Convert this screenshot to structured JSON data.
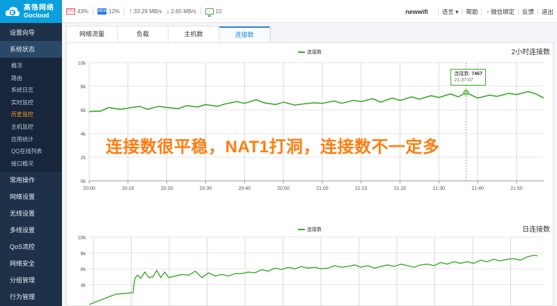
{
  "brand": {
    "name_cn": "高恪网络",
    "name_en": "Gocloud"
  },
  "sidebar": {
    "items_top": [
      {
        "label": "设置向导"
      },
      {
        "label": "系统状态"
      }
    ],
    "sub_items": [
      {
        "label": "概况"
      },
      {
        "label": "路由"
      },
      {
        "label": "系统日志"
      },
      {
        "label": "实时监控"
      },
      {
        "label": "历史监控",
        "active": true
      },
      {
        "label": "主机监控"
      },
      {
        "label": "应用统计"
      },
      {
        "label": "QQ在线列表"
      },
      {
        "label": "接口概况"
      }
    ],
    "items_bottom": [
      {
        "label": "常用操作"
      },
      {
        "label": "网络设置"
      },
      {
        "label": "无线设置"
      },
      {
        "label": "多线设置"
      },
      {
        "label": "QoS流控"
      },
      {
        "label": "网络安全"
      },
      {
        "label": "分组管理"
      },
      {
        "label": "行为管理"
      }
    ]
  },
  "topbar": {
    "cpu_icon_label": "CPU",
    "cpu": "43%",
    "mem_icon_label": "MEM",
    "mem": "12%",
    "upload": "33.29 MB/s",
    "download": "2.65 MB/s",
    "online_count": "10",
    "device_name": "newwifi",
    "links": [
      "语言",
      "帮助",
      "微信绑定",
      "反馈",
      "退出"
    ]
  },
  "tabs": [
    {
      "label": "网络流量"
    },
    {
      "label": "负载"
    },
    {
      "label": "主机数"
    },
    {
      "label": "连接数",
      "active": true
    }
  ],
  "overlay_text": "连接数很平稳，NAT1打洞，连接数不一定多",
  "colors": {
    "accent": "#2c87de",
    "series": "#3aa52a",
    "overlay": "#ff7d0f",
    "sidebar": "#1f3148"
  },
  "chart_data": [
    {
      "type": "line",
      "title": "2小时连接数",
      "legend": "连接数",
      "series": [
        {
          "name": "连接数"
        }
      ],
      "x_ticks": [
        "20:00",
        "20:10",
        "20:20",
        "20:30",
        "20:40",
        "20:50",
        "21:00",
        "21:10",
        "21:20",
        "21:30",
        "21:40",
        "21:50"
      ],
      "y_ticks": [
        "0k",
        "2k",
        "4k",
        "6k",
        "8k",
        "10k"
      ],
      "ylim": [
        0,
        10000
      ],
      "xlim_minutes": [
        0,
        117
      ],
      "x_minutes": [
        0,
        3,
        5,
        8,
        10,
        13,
        15,
        18,
        20,
        23,
        25,
        28,
        30,
        33,
        35,
        38,
        40,
        43,
        45,
        48,
        50,
        53,
        55,
        58,
        60,
        63,
        65,
        68,
        70,
        73,
        75,
        78,
        80,
        83,
        85,
        88,
        90,
        93,
        95,
        97,
        100,
        103,
        105,
        108,
        110,
        113,
        115,
        117
      ],
      "values": [
        5850,
        5900,
        6200,
        6050,
        6150,
        6300,
        6050,
        6300,
        6200,
        6100,
        6350,
        6250,
        6450,
        6300,
        6500,
        6700,
        6550,
        6850,
        6600,
        6450,
        6650,
        6400,
        6500,
        6600,
        6550,
        6750,
        6550,
        6800,
        6700,
        6950,
        6650,
        7000,
        6800,
        7100,
        6900,
        7200,
        7050,
        7350,
        7100,
        7467,
        7000,
        7250,
        7150,
        7400,
        7300,
        7550,
        7350,
        7000
      ],
      "grid": true,
      "tooltip": {
        "label": "连接数",
        "value": "7467",
        "time": "21:37:07"
      }
    },
    {
      "type": "line",
      "title": "日连接数",
      "legend": "连接数",
      "series": [
        {
          "name": "连接数"
        }
      ],
      "y_ticks": [
        "4k",
        "6k",
        "8k",
        "10k"
      ],
      "ylim": [
        0,
        10000
      ],
      "x": [
        0,
        40,
        66,
        69,
        73,
        78,
        84,
        90,
        96,
        102,
        108,
        114,
        120,
        130,
        140,
        150,
        160,
        170,
        180,
        190,
        200,
        210,
        220,
        230,
        240,
        250,
        260,
        270,
        280,
        290,
        300,
        310,
        320,
        330,
        340,
        350,
        360,
        370,
        380,
        390,
        400,
        410,
        420,
        430,
        440,
        450,
        460,
        470,
        480,
        490,
        500,
        510,
        520,
        530,
        540,
        550,
        560,
        570,
        580,
        590,
        600,
        610,
        620,
        630,
        640,
        650,
        660,
        670,
        676
      ],
      "values": [
        1500,
        2800,
        3000,
        4800,
        5200,
        4800,
        5600,
        4900,
        5000,
        5800,
        4900,
        5600,
        4900,
        5100,
        5300,
        5200,
        5700,
        4900,
        5500,
        5100,
        5300,
        5100,
        5400,
        5400,
        5600,
        5500,
        5900,
        5700,
        6100,
        5900,
        6200,
        6000,
        6300,
        6100,
        6200,
        6000,
        6100,
        6400,
        6200,
        6300,
        6500,
        6200,
        6400,
        6100,
        6300,
        6500,
        6300,
        6600,
        6400,
        6200,
        6500,
        6600,
        6400,
        6800,
        6600,
        6900,
        6700,
        6900,
        6700,
        7100,
        6900,
        7200,
        7000,
        7200,
        7300,
        7100,
        7500,
        7700,
        7650
      ],
      "grid": true
    }
  ]
}
